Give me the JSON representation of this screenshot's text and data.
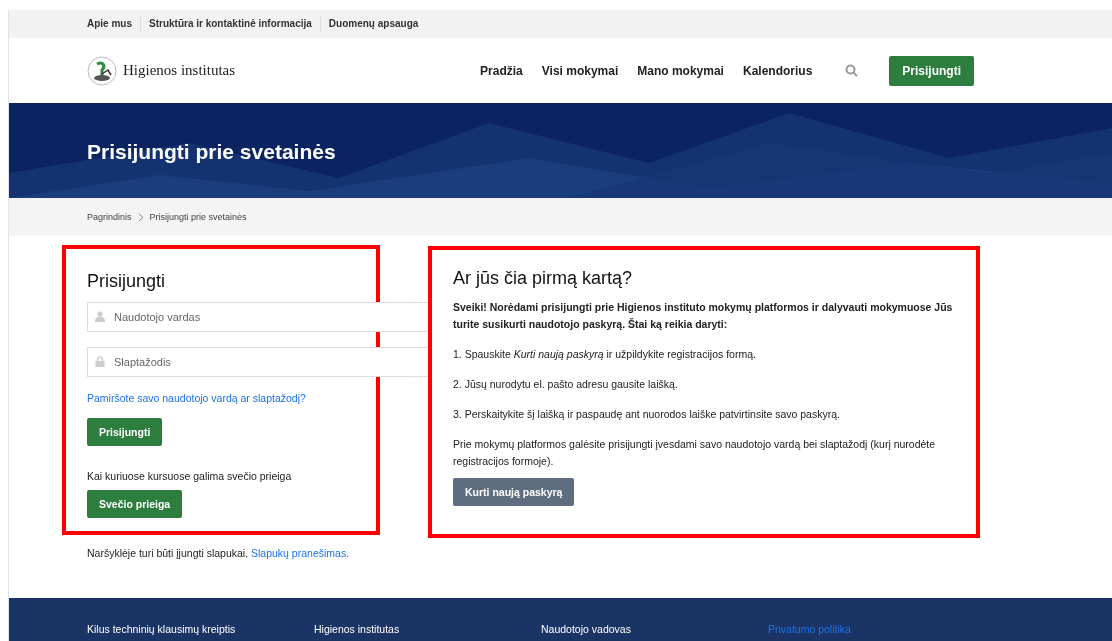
{
  "top_links": [
    "Apie mus",
    "Struktūra ir kontaktinė informacija",
    "Duomenų apsauga"
  ],
  "logo_text": "Higienos institutas",
  "nav": [
    "Pradžia",
    "Visi mokymai",
    "Mano mokymai",
    "Kalendorius"
  ],
  "login_button": "Prisijungti",
  "banner_title": "Prisijungti prie svetainės",
  "breadcrumb": [
    "Pagrindinis",
    "Prisijungti prie svetainės"
  ],
  "login_panel": {
    "title": "Prisijungti",
    "username_placeholder": "Naudotojo vardas",
    "password_placeholder": "Slaptažodis",
    "forgot_link": "Pamiršote savo naudotojo vardą ar slaptažodį?",
    "submit_button": "Prisijungti",
    "guest_note": "Kai kuriuose kursuose galima svečio prieiga",
    "guest_button": "Svečio prieiga"
  },
  "cookies": {
    "text": "Naršyklėje turi būti įjungti slapukai.",
    "link": "Slapukų pranešimas."
  },
  "signup_panel": {
    "title": "Ar jūs čia pirmą kartą?",
    "intro": "Sveiki! Norėdami prisijungti prie Higienos instituto mokymų platformos ir dalyvauti mokymuose Jūs turite susikurti naudotojo paskyrą. Štai ką reikia daryti:",
    "steps": [
      "1. Spauskite *Kurti naują paskyrą* ir užpildykite registracijos formą.",
      "2. Jūsų nurodytu el. pašto adresu gausite laišką.",
      "3. Perskaitykite šį laišką ir paspaudę ant nuorodos laiške patvirtinsite savo paskyrą."
    ],
    "note": "Prie mokymų platformos galėsite prisijungti įvesdami savo naudotojo vardą bei slaptažodį (kurį nurodėte registracijos formoje).",
    "button": "Kurti naują paskyrą"
  },
  "footer_links": [
    {
      "label": "Kilus techninių klausimų kreiptis",
      "kind": "text"
    },
    {
      "label": "Higienos institutas",
      "kind": "text"
    },
    {
      "label": "Naudotojo vadovas",
      "kind": "text"
    },
    {
      "label": "Privatumo politika",
      "kind": "link"
    }
  ]
}
